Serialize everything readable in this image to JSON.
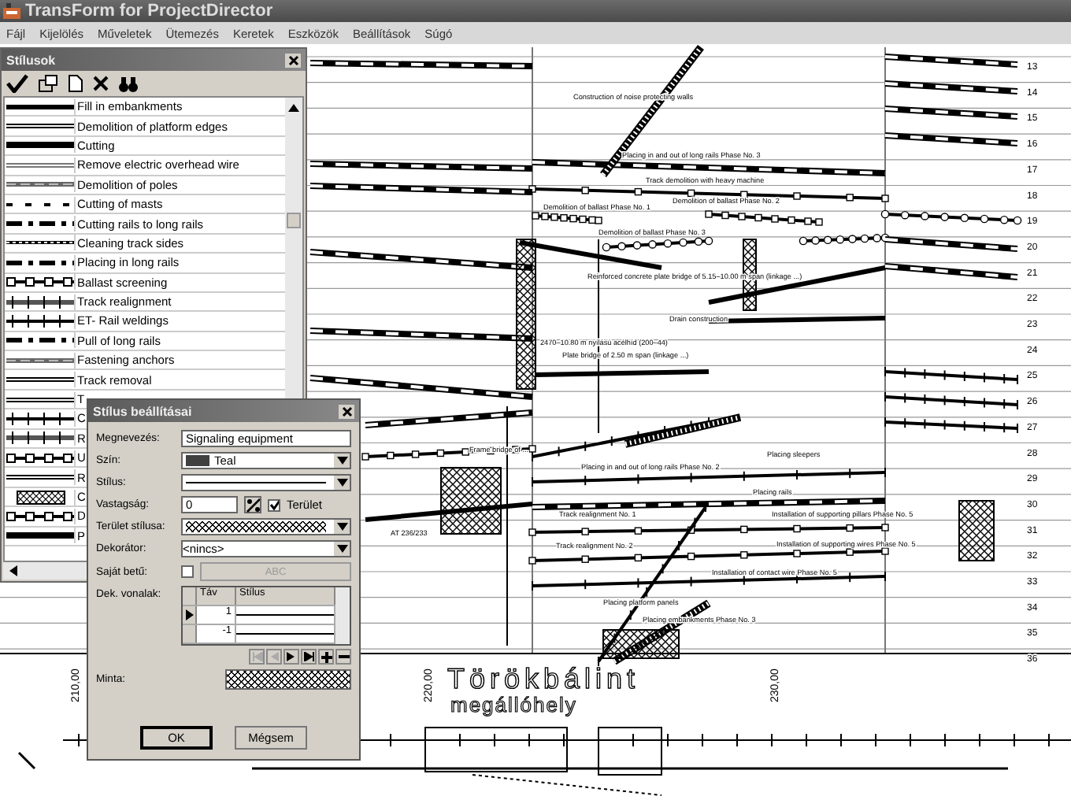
{
  "window": {
    "title": "TransForm for ProjectDirector"
  },
  "menu": [
    "Fájl",
    "Kijelölés",
    "Műveletek",
    "Ütemezés",
    "Keretek",
    "Eszközök",
    "Beállítások",
    "Súgó"
  ],
  "styles_panel": {
    "title": "Stílusok",
    "items": [
      {
        "label": "Fill in embankments",
        "kind": "thick",
        "selected": false
      },
      {
        "label": "Demolition of platform edges",
        "kind": "double",
        "selected": false
      },
      {
        "label": "Cutting",
        "kind": "bold",
        "selected": false
      },
      {
        "label": "Remove electric overhead wire",
        "kind": "graydouble",
        "selected": false
      },
      {
        "label": "Demolition of poles",
        "kind": "graydash",
        "selected": false
      },
      {
        "label": "Cutting of masts",
        "kind": "sparse",
        "selected": false
      },
      {
        "label": "Cutting rails to long rails",
        "kind": "dashgap",
        "selected": false
      },
      {
        "label": "Cleaning track sides",
        "kind": "fine",
        "selected": false
      },
      {
        "label": "Placing in long rails",
        "kind": "dashgap",
        "selected": false
      },
      {
        "label": "Ballast screening",
        "kind": "boxes",
        "selected": false
      },
      {
        "label": "Track realignment",
        "kind": "grayticks",
        "selected": false
      },
      {
        "label": "ET- Rail weldings",
        "kind": "ticked",
        "selected": false
      },
      {
        "label": "Pull of long rails",
        "kind": "dashgap",
        "selected": false
      },
      {
        "label": "Fastening anchors",
        "kind": "graydash",
        "selected": false
      },
      {
        "label": "Track removal",
        "kind": "double",
        "selected": false
      },
      {
        "label": "T",
        "kind": "double",
        "selected": false
      },
      {
        "label": "C",
        "kind": "ticked",
        "selected": false
      },
      {
        "label": "R",
        "kind": "grayticks",
        "selected": false
      },
      {
        "label": "U",
        "kind": "boxes",
        "selected": false
      },
      {
        "label": "R",
        "kind": "double",
        "selected": false
      },
      {
        "label": "C",
        "kind": "hatch",
        "selected": false
      },
      {
        "label": "D",
        "kind": "boxes",
        "selected": false
      },
      {
        "label": "P",
        "kind": "bold",
        "selected": false
      }
    ]
  },
  "dialog": {
    "title": "Stílus beállításai",
    "name_label": "Megnevezés:",
    "name_value": "Signaling equipment",
    "color_label": "Szín:",
    "color_value": "Teal",
    "style_label": "Stílus:",
    "thickness_label": "Vastagság:",
    "thickness_value": "0",
    "area_checkbox": {
      "label": "Terület",
      "checked": true
    },
    "area_style_label": "Terület stílusa:",
    "decorator_label": "Dekorátor:",
    "decorator_value": "<nincs>",
    "own_font_label": "Saját betű:",
    "own_font_checked": false,
    "font_button": "ABC",
    "font_button_disabled": true,
    "deco_lines_label": "Dek. vonalak:",
    "deco_columns": [
      "Táv",
      "Stílus"
    ],
    "deco_rows": [
      {
        "distance": "1",
        "selected": true
      },
      {
        "distance": "-1",
        "selected": false
      }
    ],
    "sample_label": "Minta:",
    "buttons": [
      "OK",
      "Mégsem"
    ]
  },
  "schedule": {
    "row_numbers": [
      "13",
      "14",
      "15",
      "16",
      "17",
      "18",
      "19",
      "20",
      "21",
      "22",
      "23",
      "24",
      "25",
      "26",
      "27",
      "28",
      "29",
      "30",
      "31",
      "32",
      "33",
      "34",
      "35",
      "36"
    ],
    "task_labels": [
      "Construction of noise protecting walls",
      "Placing in and out of long rails Phase No. 3",
      "Track demolition with heavy machine",
      "Demolition of ballast Phase No. 1",
      "Demolition of ballast Phase No. 2",
      "Demolition of ballast Phase No. 3",
      "Reinforced concrete plate bridge of 5.15–10.00 m span (linkage ...)",
      "Drain construction",
      "2470–10.80 m nyílású acélhíd (200–44)",
      "Plate bridge of 2.50 m span (linkage ...)",
      "Frame bridge of ...",
      "Placing in and out of long rails Phase No. 2",
      "Placing sleepers",
      "Placing rails",
      "Track realignment No. 1",
      "Installation of supporting pillars Phase No. 5",
      "Track realignment No. 2",
      "Installation of supporting wires Phase No. 5",
      "Installation of contact wire Phase No. 5",
      "Placing platform panels",
      "Placing embankments Phase No. 3",
      "AT 236/233"
    ],
    "station_name": "Törökbálint",
    "station_type": "megállóhely",
    "chainage_marks": [
      "210,00",
      "220,00",
      "230,00"
    ]
  }
}
